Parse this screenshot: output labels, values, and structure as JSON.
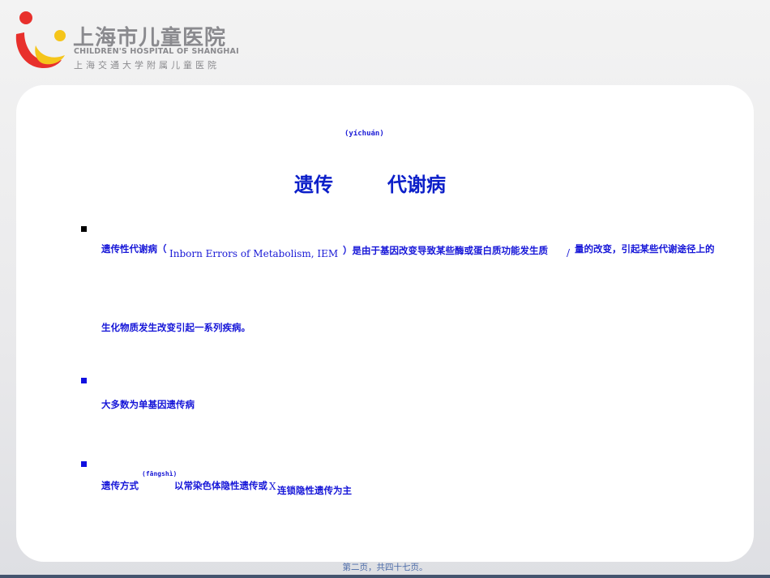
{
  "header": {
    "logo_cn": "上海市儿童医院",
    "logo_en": "CHILDREN'S HOSPITAL OF SHANGHAI",
    "logo_sub": "上海交通大学附属儿童医院"
  },
  "slide": {
    "title_ruby": "(yíchuán)",
    "title_part1": "遗传",
    "title_part2": "代谢病",
    "bullets": [
      {
        "prefix": "遗传性代谢病（",
        "english": "Inborn Errors of Metabolism, IEM",
        "after_english": "）是由于基因改变导致某些酶或蛋白质功能发生质",
        "slash": "/",
        "tail": "量的改变，引起某些代谢途径上的",
        "line2": "生化物质发生改变引起一系列疾病。"
      },
      {
        "text": "大多数为单基因遗传病"
      },
      {
        "prefix": "遗传方式",
        "ruby": "(fāngshì)",
        "middle": "以常染色体隐性遗传或",
        "x": "X",
        "tail": "连锁隐性遗传为主"
      }
    ]
  },
  "footer": {
    "page_text": "第二页，共四十七页。"
  },
  "colors": {
    "text_blue": "#1616d8",
    "title_blue": "#0c1fc9",
    "logo_red": "#e8302c",
    "logo_yellow": "#f5c51a"
  }
}
